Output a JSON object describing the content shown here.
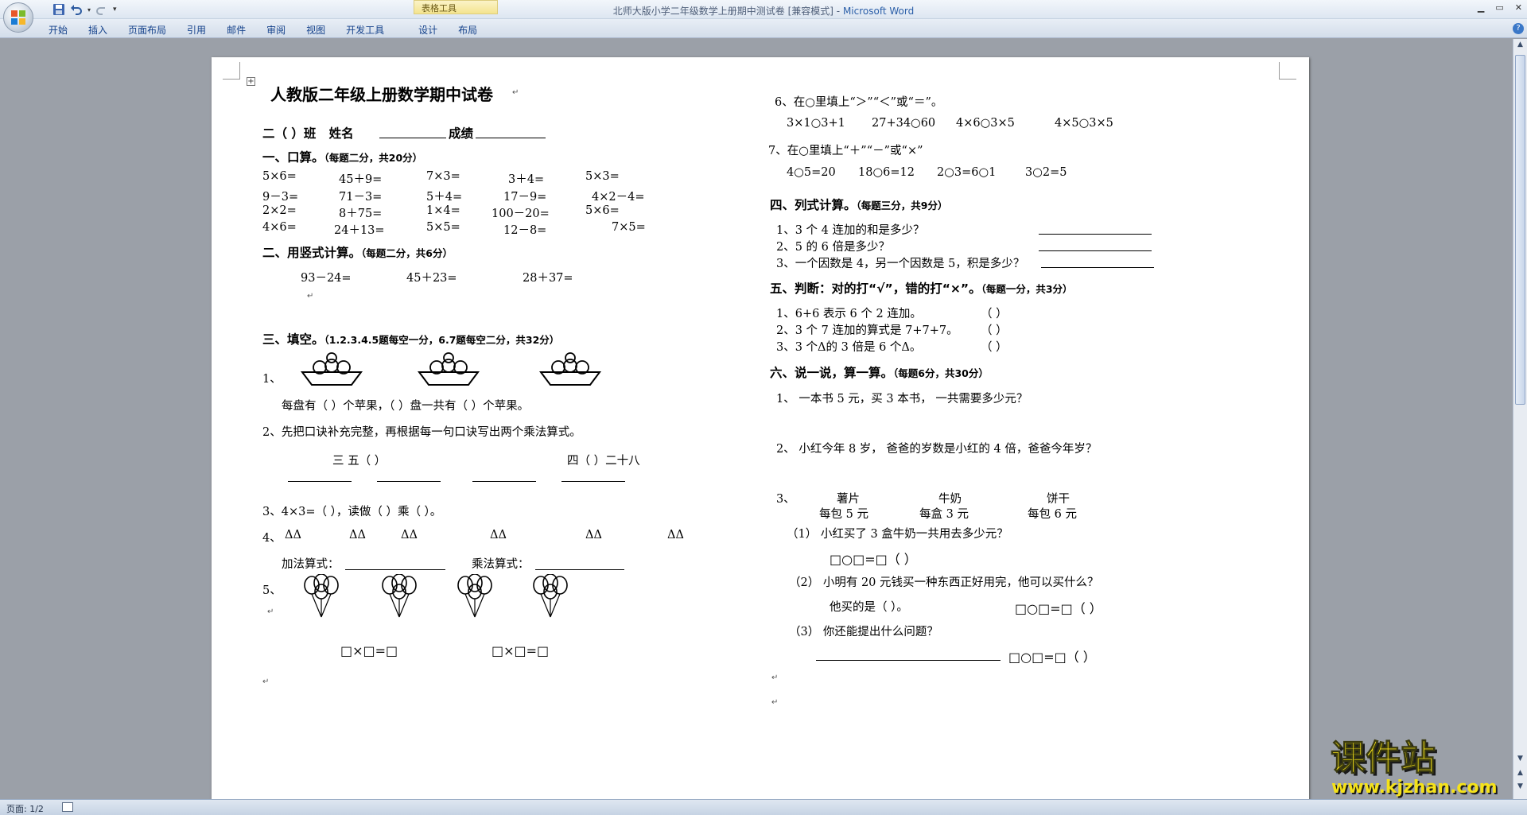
{
  "window": {
    "title": "北师大版小学二年级数学上册期中测试卷 [兼容模式] - Microsoft Word",
    "title_doc": "北师大版小学二年级数学上册期中测试卷 [兼容模式]",
    "title_app": "Microsoft Word",
    "context_tab_group": "表格工具"
  },
  "ribbon": {
    "tabs": [
      "开始",
      "插入",
      "页面布局",
      "引用",
      "邮件",
      "审阅",
      "视图",
      "开发工具",
      "设计",
      "布局"
    ]
  },
  "status": {
    "page": "页面: 1/2"
  },
  "watermark": {
    "brand": "课件站",
    "url": "www.kjzhan.com"
  },
  "colors": {
    "ribbon_text": "#15428b",
    "watermark_fill": "#f5e21a",
    "watermark_shadow": "#1a1a1a"
  },
  "doc": {
    "title": "人教版二年级上册数学期中试卷",
    "info": {
      "class": "二（   ）班",
      "name_label": "姓名",
      "score_label": "成绩"
    },
    "s1": {
      "head": "一、口算。",
      "note": "（每题二分，共20分）",
      "rows": [
        [
          "5×6=",
          "45＋9=",
          "7×3=",
          "3＋4=",
          "5×3="
        ],
        [
          "9－3=",
          "71－3=",
          "5＋4=",
          "17－9=",
          "4×2－4="
        ],
        [
          "2×2=",
          "8＋75=",
          "1×4=",
          "100－20=",
          "5×6="
        ],
        [
          "4×6=",
          "24＋13=",
          "5×5=",
          "12－8=",
          "7×5="
        ]
      ]
    },
    "s2": {
      "head": "二、用竖式计算。",
      "note": "（每题二分，共6分）",
      "items": [
        "93－24=",
        "45＋23=",
        "28＋37="
      ]
    },
    "s3": {
      "head": "三、填空。",
      "note": "（1.2.3.4.5题每空一分，6.7题每空二分，共32分）",
      "q1": "1、",
      "q1_text": "每盘有（      ）个苹果，（    ）盘一共有（      ）个苹果。",
      "q2": "2、先把口诀补充完整，再根据每一句口诀写出两个乘法算式。",
      "q2_a": "三 五（              ）",
      "q2_b": "四（          ）二十八",
      "q3": "3、4×3=（         ），读做（      ）乘（      ）。",
      "q4": "4、",
      "q4_groups": [
        "ΔΔ",
        "ΔΔ",
        "ΔΔ",
        "ΔΔ",
        "ΔΔ",
        "ΔΔ"
      ],
      "q4_add": "加法算式：",
      "q4_mul": "乘法算式：",
      "q5": "5、",
      "q5_f1": "□×□=□",
      "q5_f2": "□×□=□"
    },
    "s6_7": {
      "q6": "6、在○里填上“＞”“＜”或“＝”。",
      "q6_items": [
        "3×1○3+1",
        "27+34○60",
        "4×6○3×5",
        "4×5○3×5"
      ],
      "q7": "7、在○里填上“＋”“－”或“×”",
      "q7_items": [
        "4○5=20",
        "18○6=12",
        "2○3=6○1",
        "3○2=5"
      ]
    },
    "s4": {
      "head": "四、列式计算。",
      "note": "（每题三分，共9分）",
      "items": [
        "1、3 个 4 连加的和是多少？",
        "2、5 的 6 倍是多少？",
        "3、一个因数是 4，另一个因数是 5，积是多少？"
      ]
    },
    "s5": {
      "head": "五、判断：对的打“√”，错的打“×”。",
      "note": "（每题一分，共3分）",
      "items": [
        "1、6+6 表示 6 个 2 连加。",
        "2、3 个 7 连加的算式是 7+7+7。",
        "3、3 个Δ的 3 倍是 6 个Δ。"
      ],
      "paren": "（    ）"
    },
    "s6": {
      "head": "六、说一说，算一算。",
      "note": "（每题6分，共30分）",
      "q1": "1、    一本书 5 元，买 3 本书，    一共需要多少元？",
      "q2": "2、    小红今年 8 岁，    爸爸的岁数是小红的 4 倍，爸爸今年岁？",
      "q3": "3、",
      "goods": [
        {
          "name": "薯片",
          "price": "每包 5 元"
        },
        {
          "name": "牛奶",
          "price": "每盒 3 元"
        },
        {
          "name": "饼干",
          "price": "每包 6 元"
        }
      ],
      "sub1": "（1）  小红买了 3 盒牛奶一共用去多少元？",
      "sub1_f": "□○□=□（    ）",
      "sub2": "（2）   小明有 20 元钱买一种东西正好用完，他可以买什么？",
      "sub2_ans": "他买的是（          ）。",
      "sub2_f": "□○□=□（    ）",
      "sub3": "（3）  你还能提出什么问题？",
      "sub3_f": "□○□=□（  ）"
    }
  }
}
